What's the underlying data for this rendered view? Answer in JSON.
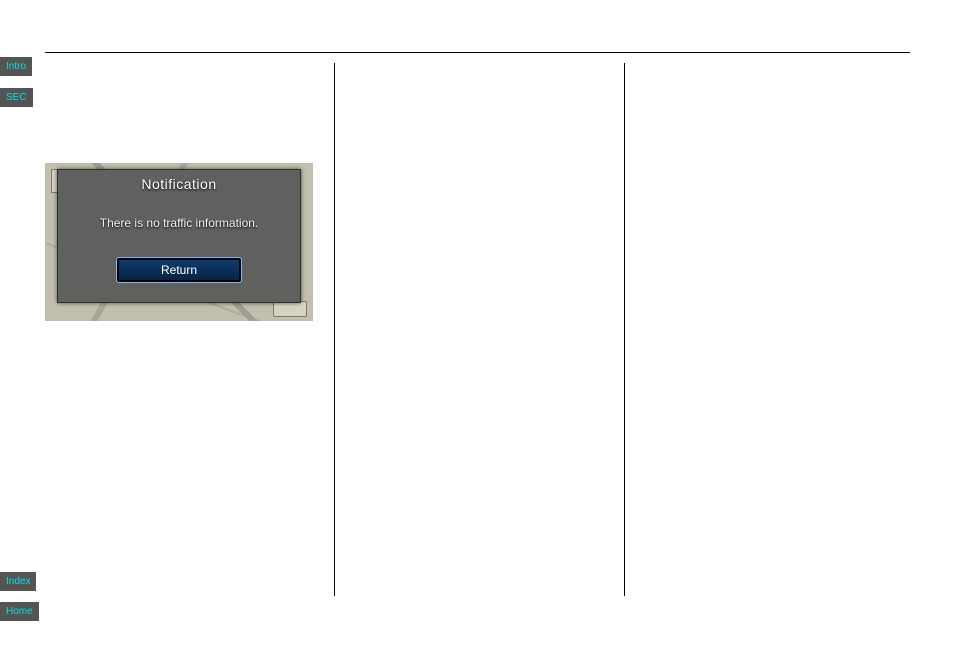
{
  "side_tabs": {
    "intro": "Intro",
    "sec": "SEC",
    "index": "Index",
    "home": "Home"
  },
  "dialog": {
    "title": "Notification",
    "message": "There is no traffic information.",
    "return_label": "Return"
  }
}
